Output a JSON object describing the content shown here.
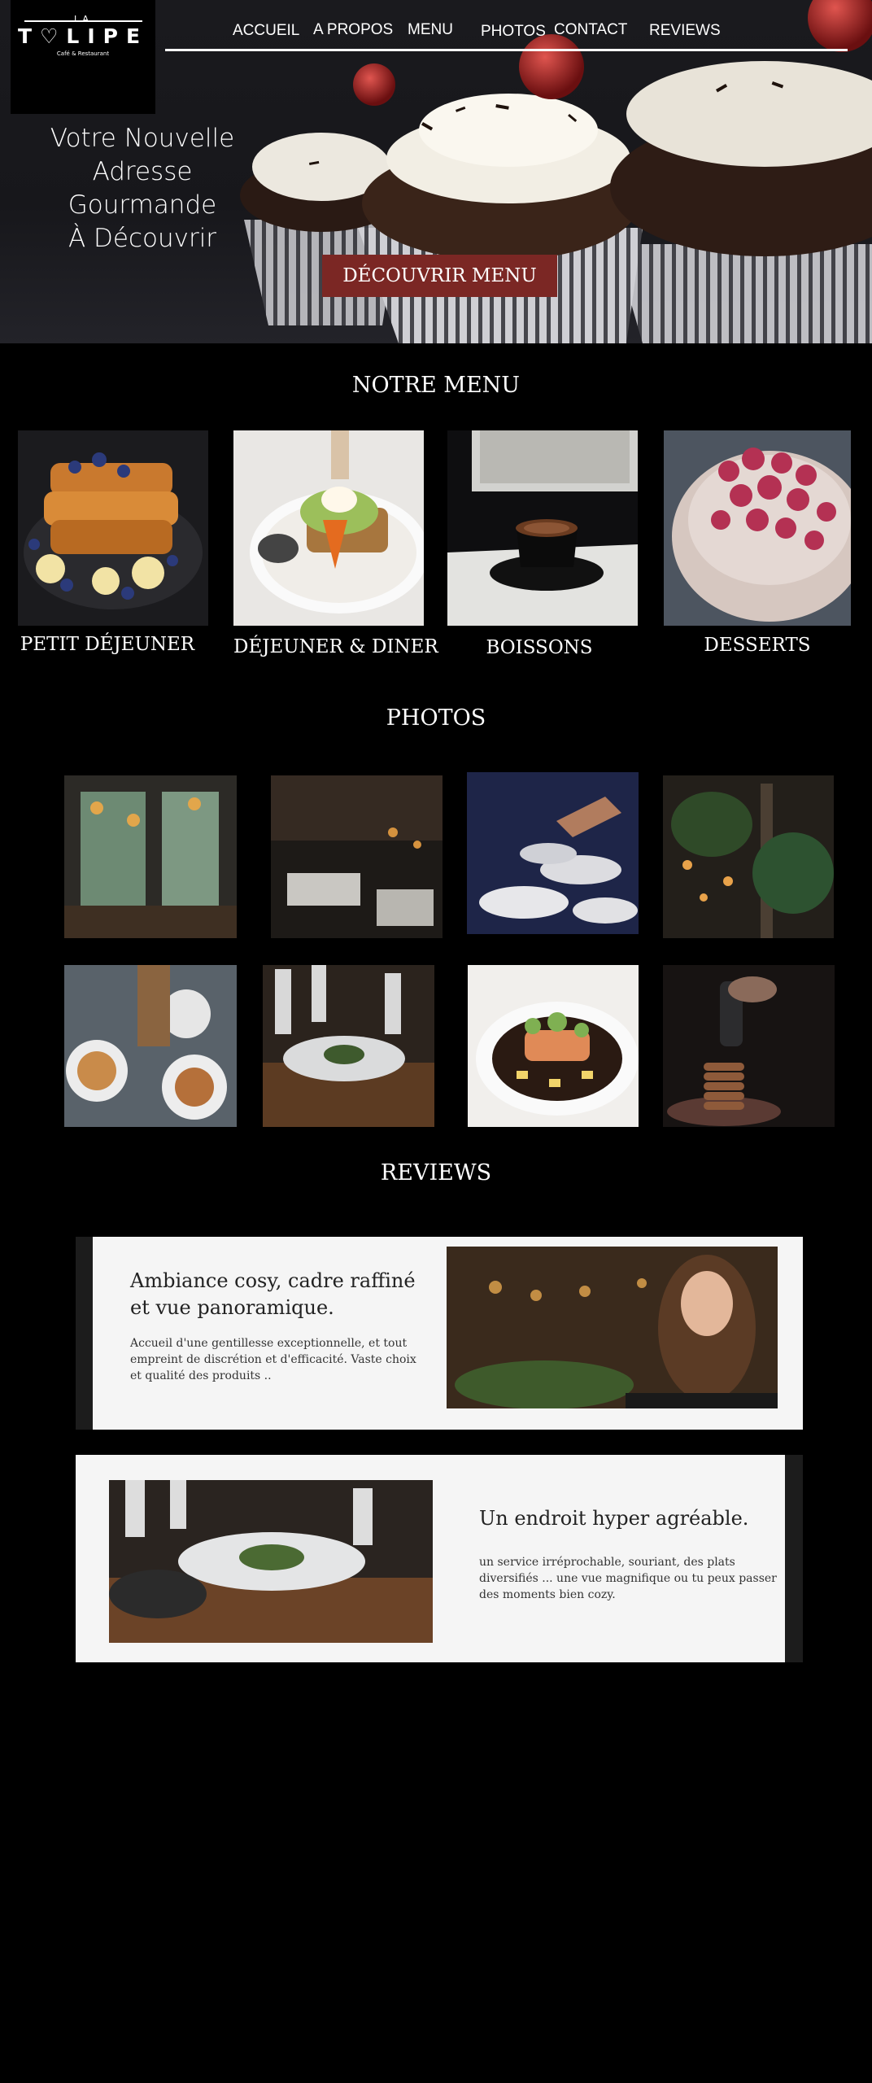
{
  "brand": {
    "logo_top": "LA",
    "logo_name": "T♡LIPE",
    "logo_sub": "Café & Restaurant"
  },
  "nav": {
    "items": [
      "ACCUEIL",
      "A PROPOS",
      "MENU",
      "PHOTOS",
      "CONTACT",
      "REVIEWS"
    ]
  },
  "hero": {
    "title_line1": "Votre Nouvelle",
    "title_line2": "Adresse Gourmande",
    "title_line3": "À Découvrir",
    "button_label": "DÉCOUVRIR MENU"
  },
  "menu_section": {
    "title": "NOTRE MENU",
    "items": [
      {
        "label": "PETIT DÉJEUNER",
        "image": "french-toast-image"
      },
      {
        "label": "DÉJEUNER & DINER",
        "image": "avocado-toast-image"
      },
      {
        "label": "BOISSONS",
        "image": "coffee-cup-image"
      },
      {
        "label": "DESSERTS",
        "image": "raspberry-cake-image"
      }
    ]
  },
  "photos_section": {
    "title": "PHOTOS"
  },
  "reviews_section": {
    "title": "REVIEWS",
    "reviews": [
      {
        "title": "Ambiance cosy, cadre raffiné et vue panoramique.",
        "text": "Accueil d'une gentillesse exceptionnelle, et tout empreint de discrétion et d'efficacité. Vaste choix et qualité des produits .."
      },
      {
        "title": "Un endroit hyper agréable.",
        "text": "un service irréprochable, souriant, des plats diversifiés ... une vue magnifique ou tu peux passer des moments bien cozy."
      }
    ]
  },
  "colors": {
    "background": "#000000",
    "accent": "#7b2724",
    "card": "#f5f5f5"
  }
}
